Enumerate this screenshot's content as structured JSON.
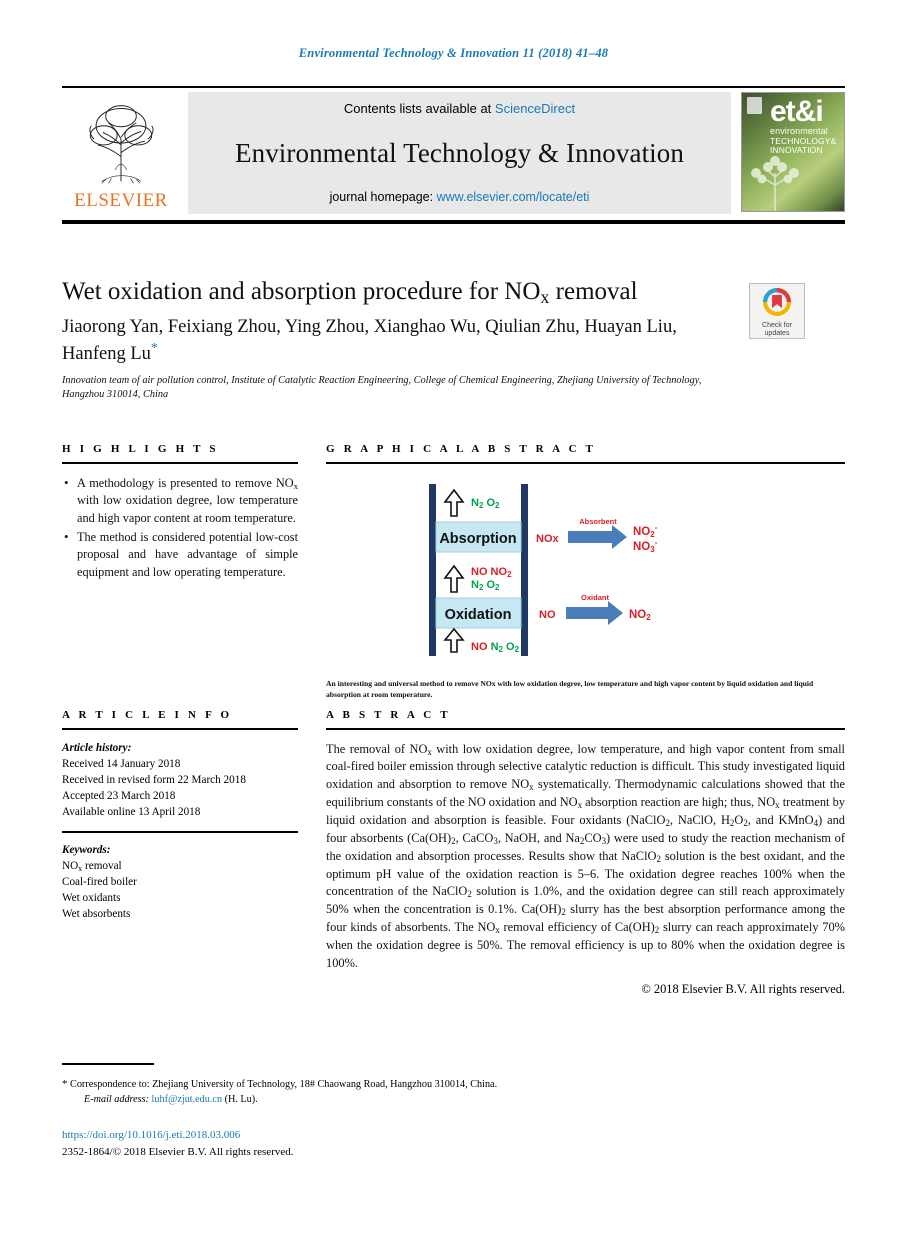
{
  "running_head": "Environmental Technology & Innovation 11 (2018) 41–48",
  "masthead": {
    "contents_prefix": "Contents lists available at ",
    "sciencedirect": "ScienceDirect",
    "journal_title": "Environmental Technology & Innovation",
    "homepage_prefix": "journal homepage: ",
    "homepage_url": "www.elsevier.com/locate/eti",
    "publisher": "ELSEVIER",
    "cover": {
      "logo": "et&i",
      "line1": "environmental",
      "line2": "TECHNOLOGY&",
      "line3": "INNOVATION"
    }
  },
  "article": {
    "title_main": "Wet oxidation and absorption procedure for NO",
    "title_sub": "x",
    "title_tail": " removal",
    "authors": "Jiaorong Yan, Feixiang Zhou, Ying Zhou, Xianghao Wu, Qiulian Zhu, Huayan Liu, Hanfeng Lu",
    "affiliation": "Innovation team of air pollution control, Institute of Catalytic Reaction Engineering, College of Chemical Engineering, Zhejiang University of Technology, Hangzhou 310014, China"
  },
  "crossmark": {
    "line1": "Check for",
    "line2": "updates"
  },
  "highlights": {
    "heading": "H I G H L I G H T S",
    "items": [
      "A methodology is presented to remove NOx with low oxidation degree, low temperature and high vapor content at room temperature.",
      "The method is considered potential low-cost proposal and have advantage of simple equipment and low operating temperature."
    ]
  },
  "graphical_abstract": {
    "heading": "G R A P H I C A L   A B S T R A C T",
    "caption": "An interesting and universal method to remove NOx with low oxidation degree, low temperature and high vapor content by liquid oxidation and liquid absorption at room temperature.",
    "diagram": {
      "stage_top": "Absorption",
      "stage_bottom": "Oxidation",
      "gas_top": "N2 O2",
      "gas_mid_red": "NO  NO2",
      "gas_mid_green": "N2 O2",
      "gas_bottom_red": "NO",
      "gas_bottom_green": "N2 O2",
      "reaction_top_label": "Absorbent",
      "reaction_top_in": "NOx",
      "reaction_top_out1": "NO2-",
      "reaction_top_out2": "NO3-",
      "reaction_bottom_label": "Oxidant",
      "reaction_bottom_in": "NO",
      "reaction_bottom_out": "NO2",
      "colors": {
        "column": "#1f3864",
        "stage_fill": "#c5e8f2",
        "arrow": "#4a7ebb",
        "red": "#d81f26",
        "green": "#00a14b"
      }
    }
  },
  "article_info": {
    "heading": "A R T I C L E   I N F O",
    "history_label": "Article history:",
    "history": [
      "Received 14 January 2018",
      "Received in revised form 22 March 2018",
      "Accepted 23 March 2018",
      "Available online 13 April 2018"
    ],
    "keywords_label": "Keywords:",
    "keywords": [
      "NOx removal",
      "Coal-fired boiler",
      "Wet oxidants",
      "Wet absorbents"
    ]
  },
  "abstract": {
    "heading": "A B S T R A C T",
    "copyright": "© 2018 Elsevier B.V. All rights reserved."
  },
  "footer": {
    "correspondence_star": "*",
    "correspondence": "Correspondence to: Zhejiang University of Technology, 18# Chaowang Road, Hangzhou 310014, China.",
    "email_label": "E-mail address:",
    "email": "luhf@zjut.edu.cn",
    "email_suffix": "(H. Lu).",
    "doi": "https://doi.org/10.1016/j.eti.2018.03.006",
    "issn": "2352-1864/© 2018 Elsevier B.V. All rights reserved."
  }
}
